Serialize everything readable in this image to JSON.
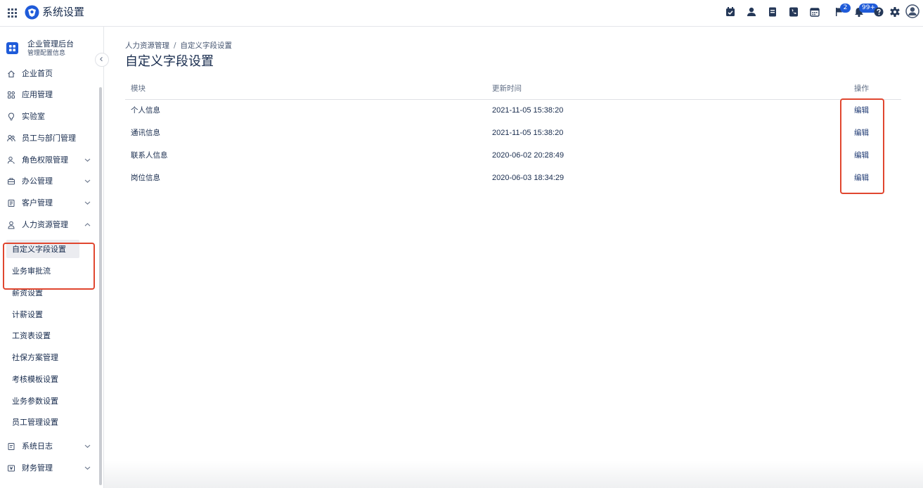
{
  "app": {
    "title": "系统设置"
  },
  "topbar": {
    "icons": [
      "apps-grid-icon",
      "app-logo-icon",
      "calendar-check-icon",
      "user-icon",
      "document-icon",
      "phone-icon",
      "calendar-icon",
      "flag-icon",
      "bell-icon",
      "help-icon",
      "settings-icon",
      "avatar-icon"
    ],
    "flag_badge": "2",
    "bell_badge": "99+"
  },
  "sidebar": {
    "org_name": "企业管理后台",
    "org_subtitle": "管理配置信息",
    "items": [
      {
        "label": "企业首页",
        "icon": "home-icon",
        "expandable": false
      },
      {
        "label": "应用管理",
        "icon": "apps-icon",
        "expandable": false
      },
      {
        "label": "实验室",
        "icon": "lightbulb-icon",
        "expandable": false
      },
      {
        "label": "员工与部门管理",
        "icon": "team-icon",
        "expandable": false
      },
      {
        "label": "角色权限管理",
        "icon": "role-icon",
        "expandable": true
      },
      {
        "label": "办公管理",
        "icon": "office-icon",
        "expandable": true
      },
      {
        "label": "客户管理",
        "icon": "customer-icon",
        "expandable": true
      },
      {
        "label": "人力资源管理",
        "icon": "person-icon",
        "expandable": true,
        "expanded": true
      }
    ],
    "sub_items": [
      {
        "label": "自定义字段设置",
        "active": true
      },
      {
        "label": "业务审批流"
      },
      {
        "label": "薪资设置"
      },
      {
        "label": "计薪设置"
      },
      {
        "label": "工资表设置"
      },
      {
        "label": "社保方案管理"
      },
      {
        "label": "考核模板设置"
      },
      {
        "label": "业务参数设置"
      },
      {
        "label": "员工管理设置"
      }
    ],
    "bottom_items": [
      {
        "label": "系统日志",
        "icon": "log-icon",
        "expandable": true
      },
      {
        "label": "财务管理",
        "icon": "finance-icon",
        "expandable": true
      }
    ]
  },
  "main": {
    "breadcrumb": [
      "人力资源管理",
      "自定义字段设置"
    ],
    "breadcrumb_separator": "/",
    "title": "自定义字段设置",
    "table": {
      "headers": [
        "模块",
        "更新时间",
        "操作"
      ],
      "rows": [
        {
          "module": "个人信息",
          "updated": "2021-11-05 15:38:20",
          "action": "编辑"
        },
        {
          "module": "通讯信息",
          "updated": "2021-11-05 15:38:20",
          "action": "编辑"
        },
        {
          "module": "联系人信息",
          "updated": "2020-06-02 20:28:49",
          "action": "编辑"
        },
        {
          "module": "岗位信息",
          "updated": "2020-06-03 18:34:29",
          "action": "编辑"
        }
      ]
    }
  },
  "colors": {
    "accent": "#1f5bd9",
    "highlight": "#e0462f",
    "text": "#172b4d",
    "active_bg": "#ebecf0"
  }
}
